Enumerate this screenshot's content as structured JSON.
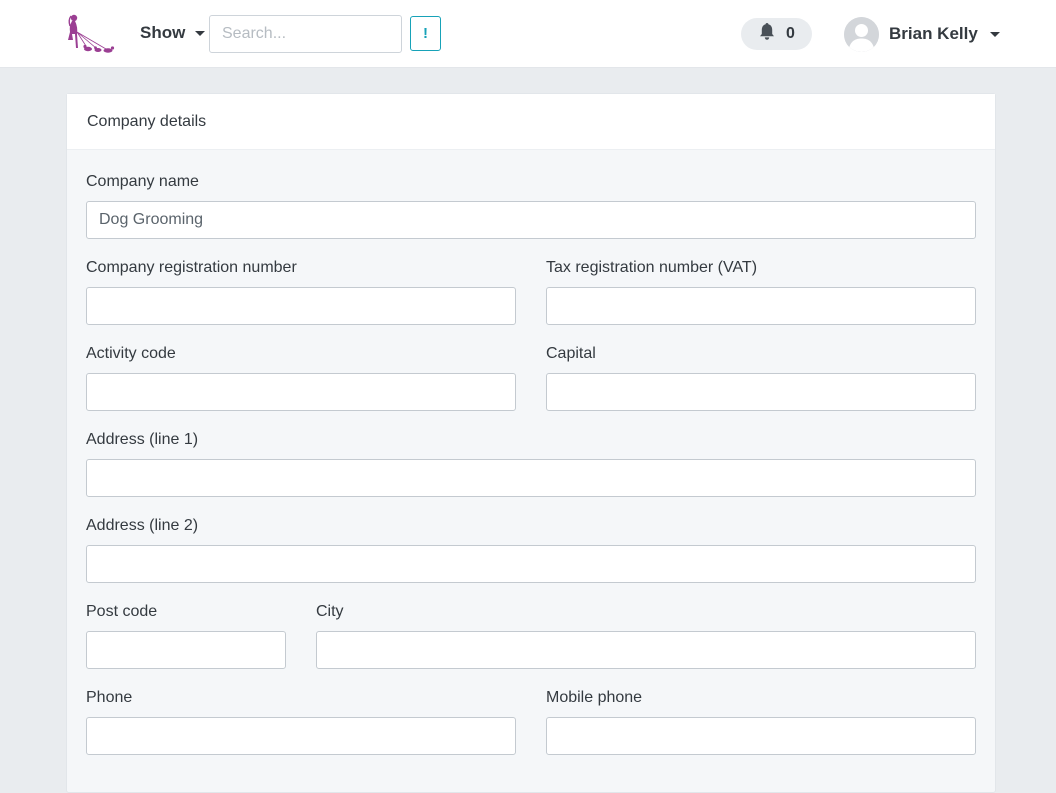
{
  "navbar": {
    "show_label": "Show",
    "search_placeholder": "Search...",
    "alert_label": "!",
    "notification_count": "0",
    "user_name": "Brian Kelly"
  },
  "card": {
    "title": "Company details"
  },
  "form": {
    "company_name": {
      "label": "Company name",
      "value": "Dog Grooming"
    },
    "company_registration_number": {
      "label": "Company registration number",
      "value": ""
    },
    "tax_registration_number": {
      "label": "Tax registration number (VAT)",
      "value": ""
    },
    "activity_code": {
      "label": "Activity code",
      "value": ""
    },
    "capital": {
      "label": "Capital",
      "value": ""
    },
    "address_line1": {
      "label": "Address (line 1)",
      "value": ""
    },
    "address_line2": {
      "label": "Address (line 2)",
      "value": ""
    },
    "post_code": {
      "label": "Post code",
      "value": ""
    },
    "city": {
      "label": "City",
      "value": ""
    },
    "phone": {
      "label": "Phone",
      "value": ""
    },
    "mobile_phone": {
      "label": "Mobile phone",
      "value": ""
    }
  },
  "colors": {
    "brand_logo": "#9b3f93",
    "info_accent": "#17a2b8",
    "page_background": "#e9ecef"
  },
  "icons": {
    "logo": "dog-walker-logo-icon",
    "notifications": "bell-icon",
    "user": "user-avatar-icon"
  }
}
